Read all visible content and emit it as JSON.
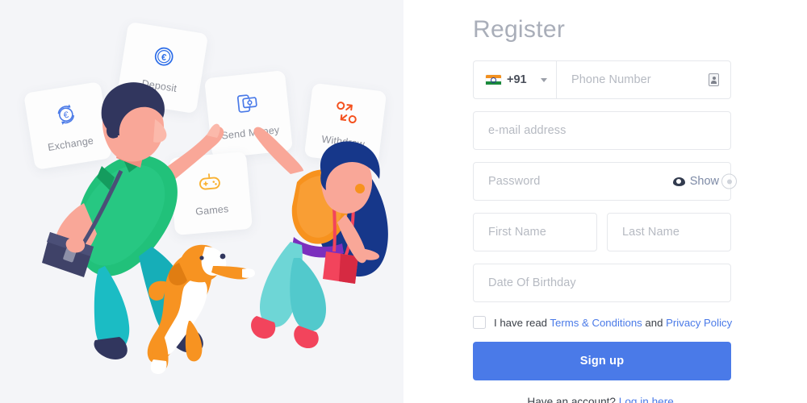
{
  "illustration": {
    "background_color": "#f4f5f8",
    "cards": [
      {
        "id": "exchange",
        "label": "Exchange",
        "icon": "euro-exchange-icon",
        "icon_color": "#4a7ae8"
      },
      {
        "id": "deposit",
        "label": "Deposit",
        "icon": "euro-coin-icon",
        "icon_color": "#2b6ce8"
      },
      {
        "id": "send",
        "label": "Send Money",
        "icon": "phone-send-money-icon",
        "icon_color": "#4a7ae8"
      },
      {
        "id": "withdraw",
        "label": "Withdraw",
        "icon": "withdraw-arrows-icon",
        "icon_color": "#f4511e"
      },
      {
        "id": "games",
        "label": "Games",
        "icon": "gamepad-icon",
        "icon_color": "#f9b233"
      }
    ],
    "characters": [
      {
        "name": "man-with-bag",
        "hair": "#31365e",
        "shirt": "#21c17a",
        "pants": "#1bbcc4",
        "skin": "#f9a798",
        "bag": "#3f4268"
      },
      {
        "name": "woman-with-handbag",
        "hair": "#16378a",
        "top": "#f7921e",
        "belt": "#7b2fbe",
        "pants": "#6ed6d6",
        "skin": "#f9a798",
        "bag": "#f2445c"
      },
      {
        "name": "jumping-dog",
        "body": "#f79321",
        "belly": "#ffffff"
      }
    ]
  },
  "form": {
    "title": "Register",
    "phone": {
      "country_flag": "india-flag-icon",
      "dial_code": "+91",
      "caret": "chevron-down-icon",
      "placeholder": "Phone Number",
      "contact_icon": "contact-card-icon"
    },
    "email": {
      "placeholder": "e-mail address"
    },
    "password": {
      "placeholder": "Password",
      "toggle_label": "Show",
      "toggle_icon": "eye-icon"
    },
    "first_name": {
      "placeholder": "First Name"
    },
    "last_name": {
      "placeholder": "Last Name"
    },
    "birthday": {
      "placeholder": "Date Of Birthday"
    },
    "terms": {
      "checked": false,
      "text_before": "I have read ",
      "link1": "Terms & Conditions",
      "text_middle": " and ",
      "link2": "Privacy Policy"
    },
    "submit_label": "Sign up",
    "login": {
      "text": "Have an account? ",
      "link": "Log in here."
    },
    "accent_color": "#4a7ae8"
  }
}
